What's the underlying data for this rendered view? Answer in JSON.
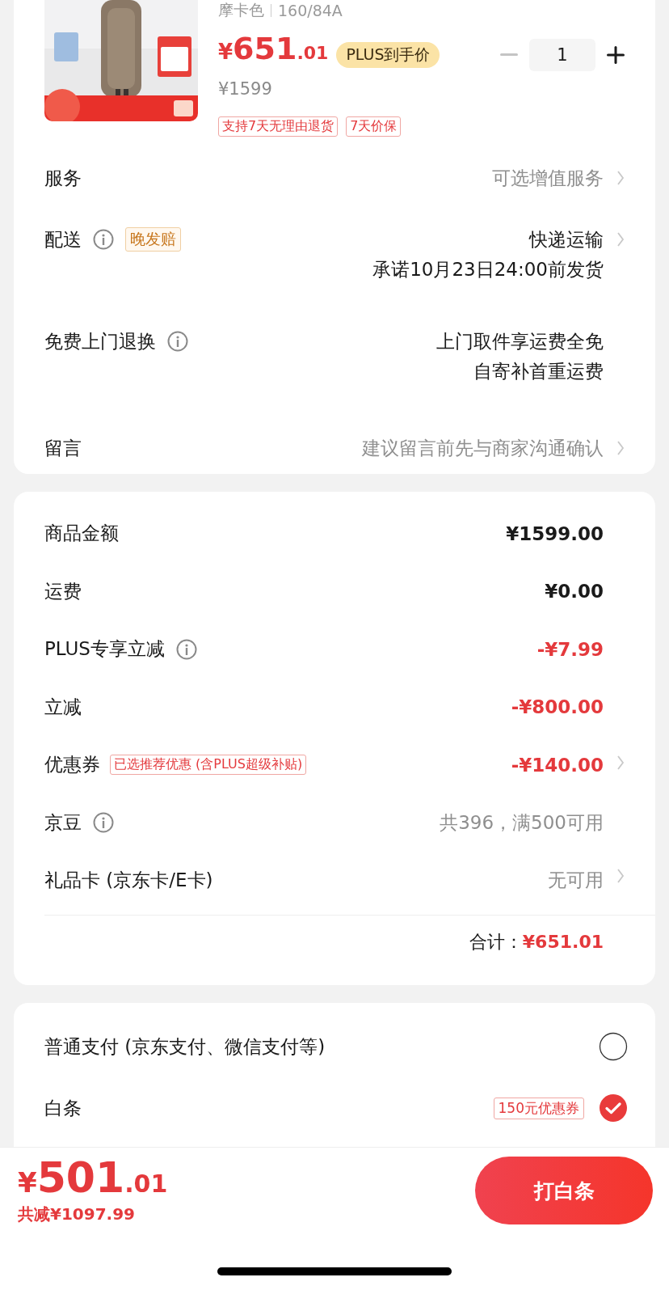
{
  "product": {
    "variant": "摩卡色",
    "size": "160/84A",
    "currency": "¥",
    "price_int": "651",
    "price_dec": ".01",
    "plus_badge": "PLUS到手价",
    "original_price": "¥1599",
    "quantity": "1",
    "tags": [
      "支持7天无理由退货",
      "7天价保"
    ]
  },
  "service_rows": [
    {
      "label": "服务",
      "info": false,
      "lines": [
        "可选增值服务"
      ],
      "kind": "muted",
      "chevron": true
    },
    {
      "label": "配送",
      "info": true,
      "badge": "晚发赔",
      "lines": [
        "快递运输",
        "承诺10月23日24:00前发货"
      ],
      "kind": "dark",
      "chevron": true
    },
    {
      "label": "免费上门退换",
      "info": true,
      "lines": [
        "上门取件享运费全免",
        "自寄补首重运费"
      ],
      "kind": "dark",
      "chevron": false
    },
    {
      "label": "留言",
      "info": false,
      "lines": [
        "建议留言前先与商家沟通确认"
      ],
      "kind": "muted",
      "chevron": true
    }
  ],
  "summary_rows": [
    {
      "label": "商品金额",
      "info": false,
      "value": "¥1599.00",
      "kind": "dark",
      "chevron": false
    },
    {
      "label": "运费",
      "info": false,
      "value": "¥0.00",
      "kind": "dark",
      "chevron": false
    },
    {
      "label": "PLUS专享立减",
      "info": true,
      "value": "-¥7.99",
      "kind": "red",
      "chevron": false
    },
    {
      "label": "立减",
      "info": false,
      "value": "-¥800.00",
      "kind": "red",
      "chevron": false
    },
    {
      "label": "优惠券",
      "info": false,
      "tag": "已选推荐优惠 (含PLUS超级补贴)",
      "value": "-¥140.00",
      "kind": "red",
      "chevron": true
    },
    {
      "label": "京豆",
      "info": true,
      "value": "共396，满500可用",
      "kind": "muted",
      "chevron": false
    },
    {
      "label": "礼品卡 (京东卡/E卡)",
      "info": false,
      "value": "无可用",
      "kind": "muted",
      "chevron": true
    }
  ],
  "total": {
    "label": "合计：",
    "value": "¥651.01"
  },
  "payment": [
    {
      "label": "普通支付 (京东支付、微信支付等)",
      "selected": false
    },
    {
      "label": "白条",
      "promo": "150元优惠券",
      "selected": true
    }
  ],
  "footer": {
    "currency": "¥",
    "amount_int": "501",
    "amount_dec": ".01",
    "saving": "共减¥1097.99",
    "button": "打白条"
  }
}
